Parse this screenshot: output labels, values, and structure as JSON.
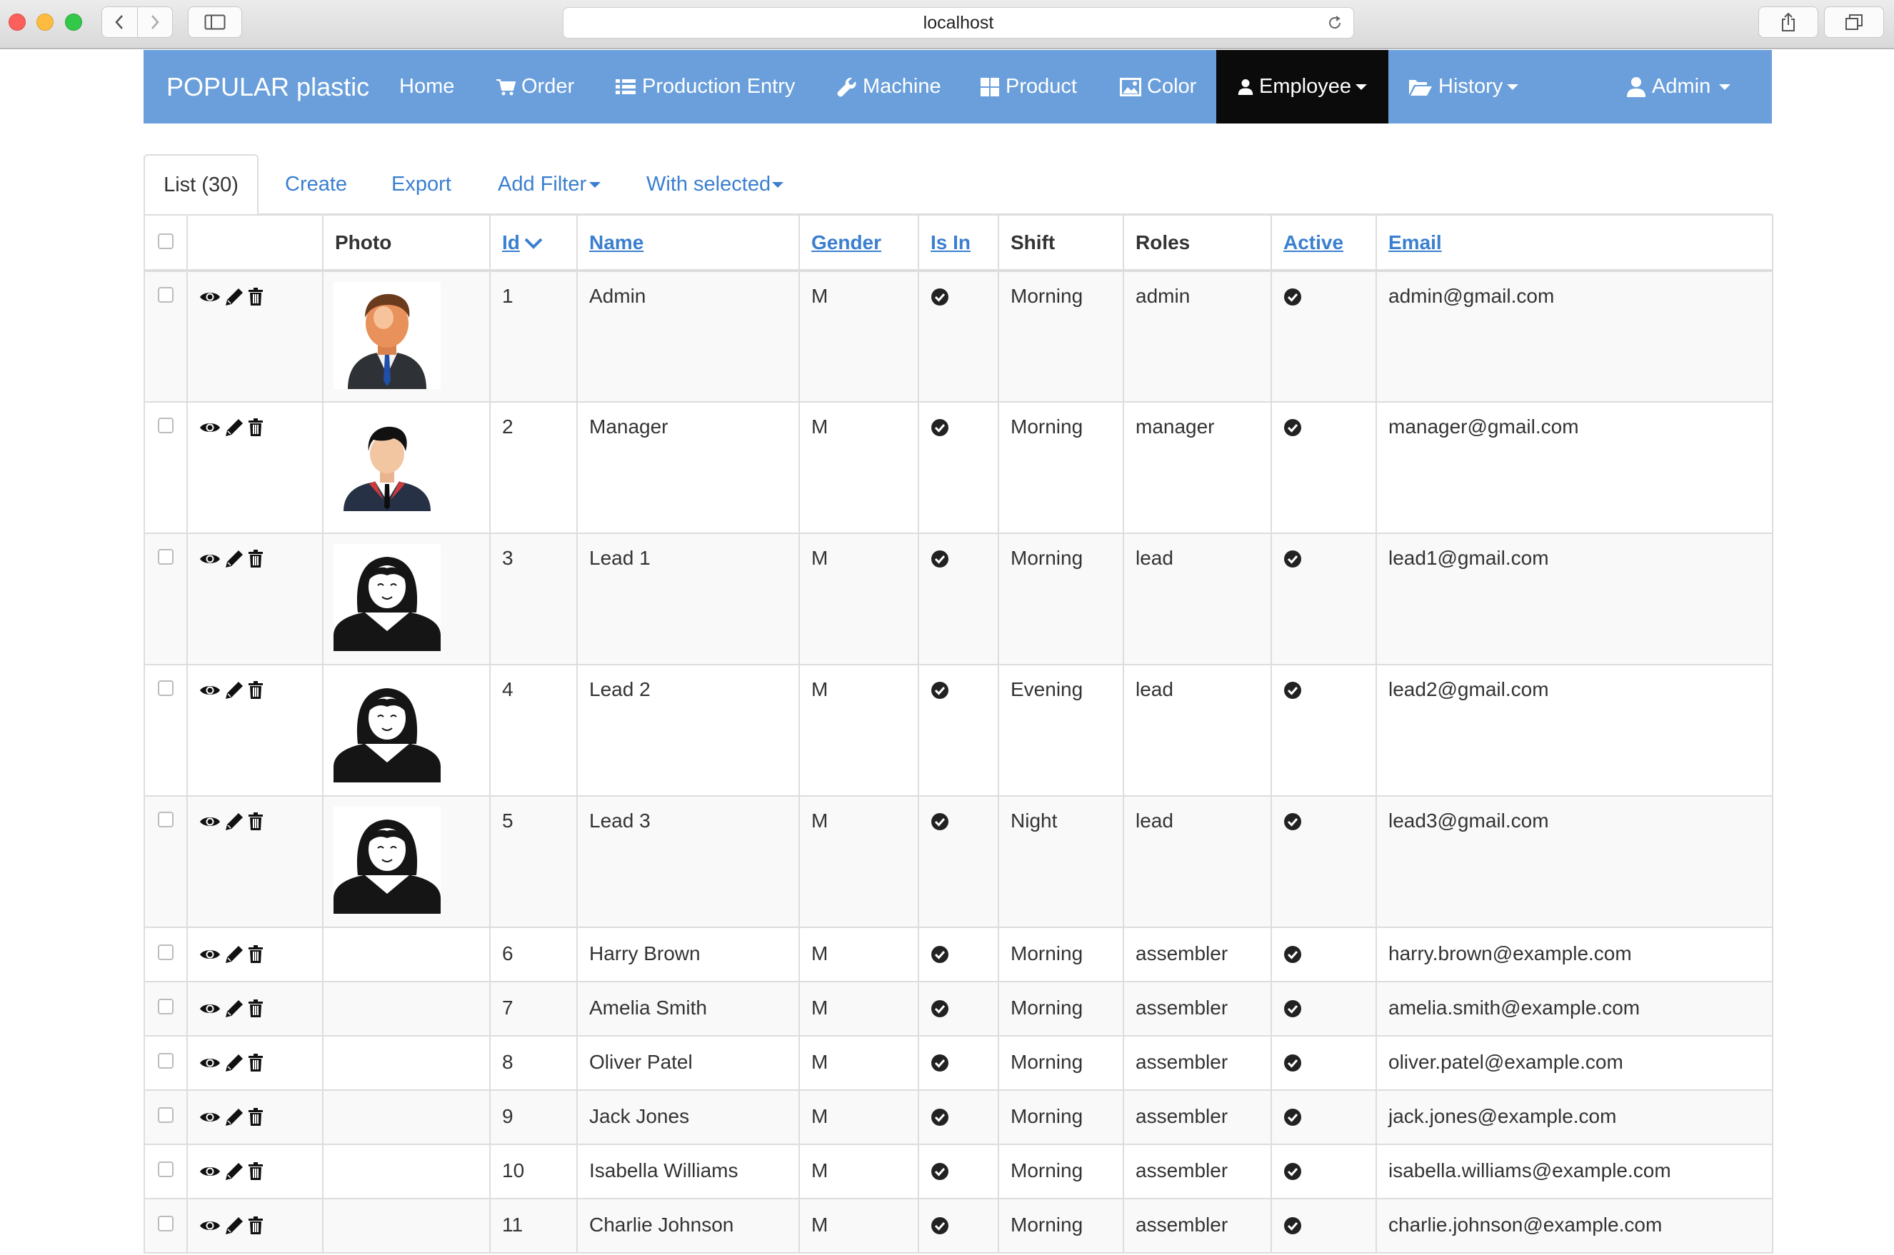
{
  "browser": {
    "url": "localhost"
  },
  "navbar": {
    "brand": "POPULAR plastic",
    "items": [
      {
        "label": "Home",
        "icon": ""
      },
      {
        "label": "Order",
        "icon": "cart-icon"
      },
      {
        "label": "Production Entry",
        "icon": "list-icon"
      },
      {
        "label": "Machine",
        "icon": "wrench-icon"
      },
      {
        "label": "Product",
        "icon": "grid-icon"
      },
      {
        "label": "Color",
        "icon": "picture-icon"
      },
      {
        "label": "Employee",
        "icon": "user-icon",
        "active": true
      },
      {
        "label": "History",
        "icon": "folder-open-icon"
      },
      {
        "label": "Admin",
        "icon": "user-icon"
      }
    ],
    "bg_color": "#6a9fdb",
    "active_bg": "#0b0b0b"
  },
  "tabs": {
    "list": "List (30)",
    "create": "Create",
    "export": "Export",
    "add_filter": "Add Filter",
    "with_selected": "With selected"
  },
  "table": {
    "headers": {
      "photo": "Photo",
      "id": "Id",
      "name": "Name",
      "gender": "Gender",
      "is_in": "Is In",
      "shift": "Shift",
      "roles": "Roles",
      "active": "Active",
      "email": "Email"
    },
    "rows": [
      {
        "id": "1",
        "name": "Admin",
        "gender": "M",
        "shift": "Morning",
        "roles": "admin",
        "email": "admin@gmail.com",
        "photo": "businessman-avatar"
      },
      {
        "id": "2",
        "name": "Manager",
        "gender": "M",
        "shift": "Morning",
        "roles": "manager",
        "email": "manager@gmail.com",
        "photo": "manager-avatar"
      },
      {
        "id": "3",
        "name": "Lead 1",
        "gender": "M",
        "shift": "Morning",
        "roles": "lead",
        "email": "lead1@gmail.com",
        "photo": "woman-silhouette-avatar"
      },
      {
        "id": "4",
        "name": "Lead 2",
        "gender": "M",
        "shift": "Evening",
        "roles": "lead",
        "email": "lead2@gmail.com",
        "photo": "woman-silhouette-avatar"
      },
      {
        "id": "5",
        "name": "Lead 3",
        "gender": "M",
        "shift": "Night",
        "roles": "lead",
        "email": "lead3@gmail.com",
        "photo": "woman-silhouette-avatar"
      },
      {
        "id": "6",
        "name": "Harry Brown",
        "gender": "M",
        "shift": "Morning",
        "roles": "assembler",
        "email": "harry.brown@example.com",
        "photo": ""
      },
      {
        "id": "7",
        "name": "Amelia Smith",
        "gender": "M",
        "shift": "Morning",
        "roles": "assembler",
        "email": "amelia.smith@example.com",
        "photo": ""
      },
      {
        "id": "8",
        "name": "Oliver Patel",
        "gender": "M",
        "shift": "Morning",
        "roles": "assembler",
        "email": "oliver.patel@example.com",
        "photo": ""
      },
      {
        "id": "9",
        "name": "Jack Jones",
        "gender": "M",
        "shift": "Morning",
        "roles": "assembler",
        "email": "jack.jones@example.com",
        "photo": ""
      },
      {
        "id": "10",
        "name": "Isabella Williams",
        "gender": "M",
        "shift": "Morning",
        "roles": "assembler",
        "email": "isabella.williams@example.com",
        "photo": ""
      },
      {
        "id": "11",
        "name": "Charlie Johnson",
        "gender": "M",
        "shift": "Morning",
        "roles": "assembler",
        "email": "charlie.johnson@example.com",
        "photo": ""
      }
    ]
  }
}
